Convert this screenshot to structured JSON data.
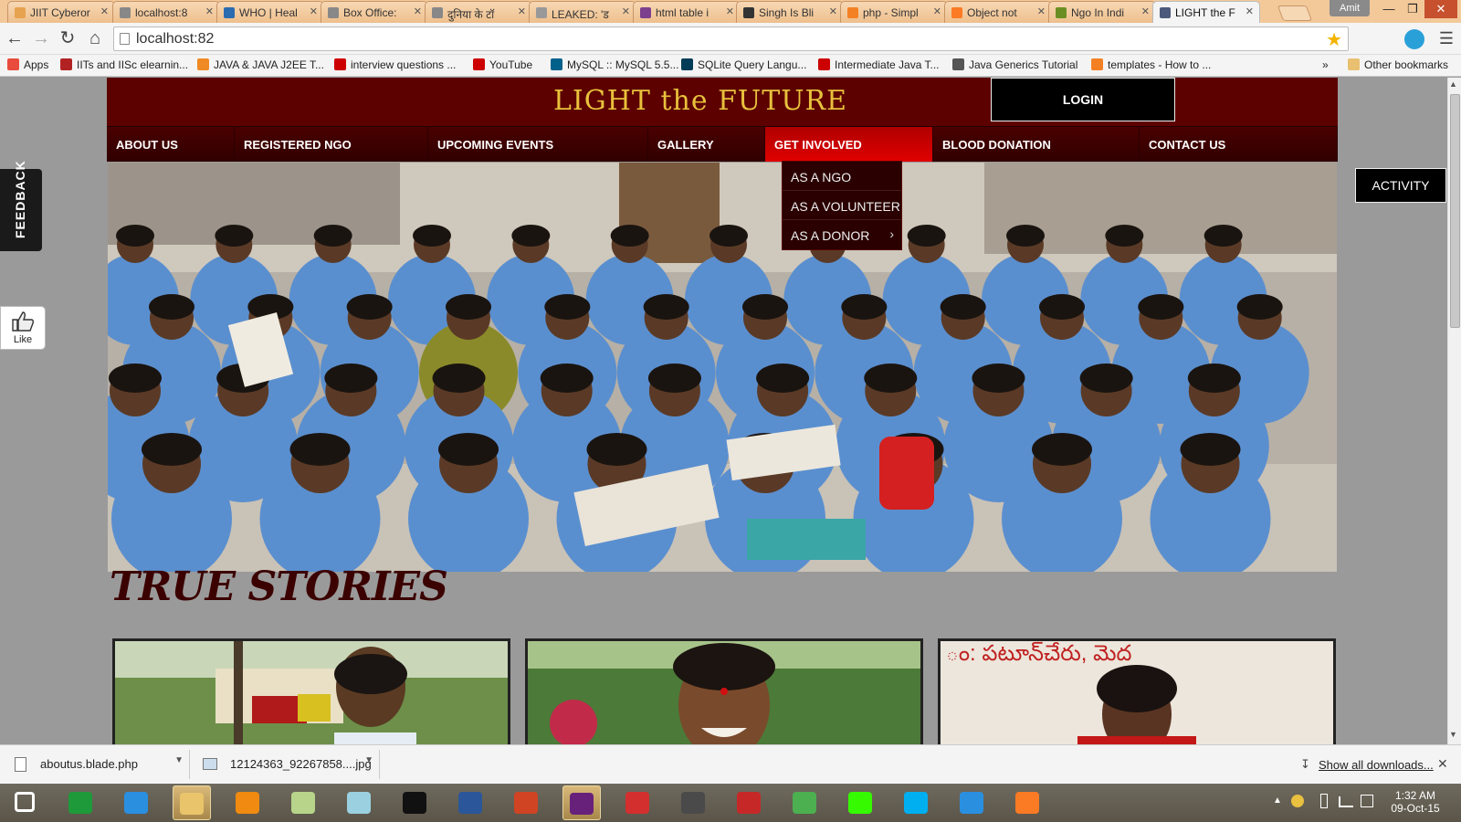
{
  "browser": {
    "tabs": [
      {
        "title": "JIIT Cyberor",
        "color": "#e7a24f"
      },
      {
        "title": "localhost:8",
        "color": "#888888"
      },
      {
        "title": "WHO | Heal",
        "color": "#2b6cb0"
      },
      {
        "title": "Box Office:",
        "color": "#888888"
      },
      {
        "title": "दुनिया के टॉ",
        "color": "#888888"
      },
      {
        "title": "LEAKED: 'ड",
        "color": "#999999"
      },
      {
        "title": "html table i",
        "color": "#7b3f8e"
      },
      {
        "title": "Singh Is Bli",
        "color": "#333333"
      },
      {
        "title": "php - Simpl",
        "color": "#f48024"
      },
      {
        "title": "Object not",
        "color": "#fb7a24"
      },
      {
        "title": "Ngo In Indi",
        "color": "#6b8e23"
      },
      {
        "title": "LIGHT the F",
        "color": "#4b5a7a",
        "active": true
      }
    ],
    "profile_name": "Amit",
    "url": "localhost:82",
    "bookmarks": [
      {
        "label": "Apps",
        "color": "#e94b3c"
      },
      {
        "label": "IITs and IISc elearnin...",
        "color": "#b22222"
      },
      {
        "label": "JAVA & JAVA J2EE T...",
        "color": "#f08a24"
      },
      {
        "label": "interview questions ...",
        "color": "#cc0000"
      },
      {
        "label": "YouTube",
        "color": "#cc0000"
      },
      {
        "label": "MySQL :: MySQL 5.5...",
        "color": "#00618a"
      },
      {
        "label": "SQLite Query Langu...",
        "color": "#003b57"
      },
      {
        "label": "Intermediate Java T...",
        "color": "#cc0000"
      },
      {
        "label": "Java Generics Tutorial",
        "color": "#555555"
      },
      {
        "label": "templates - How to ...",
        "color": "#f48024"
      }
    ],
    "other_bookmarks": "Other bookmarks"
  },
  "site": {
    "title": "LIGHT the FUTURE",
    "login_label": "LOGIN",
    "nav": [
      {
        "label": "ABOUT US"
      },
      {
        "label": "REGISTERED NGO"
      },
      {
        "label": "UPCOMING EVENTS"
      },
      {
        "label": "GALLERY"
      },
      {
        "label": "GET INVOLVED",
        "highlighted": true
      },
      {
        "label": "BLOOD DONATION"
      },
      {
        "label": "CONTACT US"
      }
    ],
    "dropdown": [
      "AS A NGO",
      "AS A VOLUNTEER",
      "AS A DONOR"
    ],
    "feedback_label": "FEEDBACK",
    "like_label": "Like",
    "activity_label": "ACTIVITY",
    "stories_title": "TRUE STORIES",
    "story_card_banner": "ం: పటూన్‌చేరు, మెద",
    "accent_color": "#5c0000",
    "title_color": "#e8c13c"
  },
  "downloads": {
    "items": [
      "aboutus.blade.php",
      "12124363_92267858....jpg"
    ],
    "show_all": "Show all downloads..."
  },
  "taskbar": {
    "apps": [
      "start-icon",
      "store-icon",
      "ie-icon",
      "explorer-icon",
      "vlc-icon",
      "folder-icon",
      "notepad-icon",
      "cmd-icon",
      "word-icon",
      "powerpoint-icon",
      "visual-studio-icon",
      "kaspersky-icon",
      "sublime-icon",
      "acrobat-icon",
      "chrome-icon",
      "dreamweaver-icon",
      "skype-icon",
      "wifi-icon",
      "xampp-icon"
    ],
    "time": "1:32 AM",
    "date": "09-Oct-15"
  }
}
